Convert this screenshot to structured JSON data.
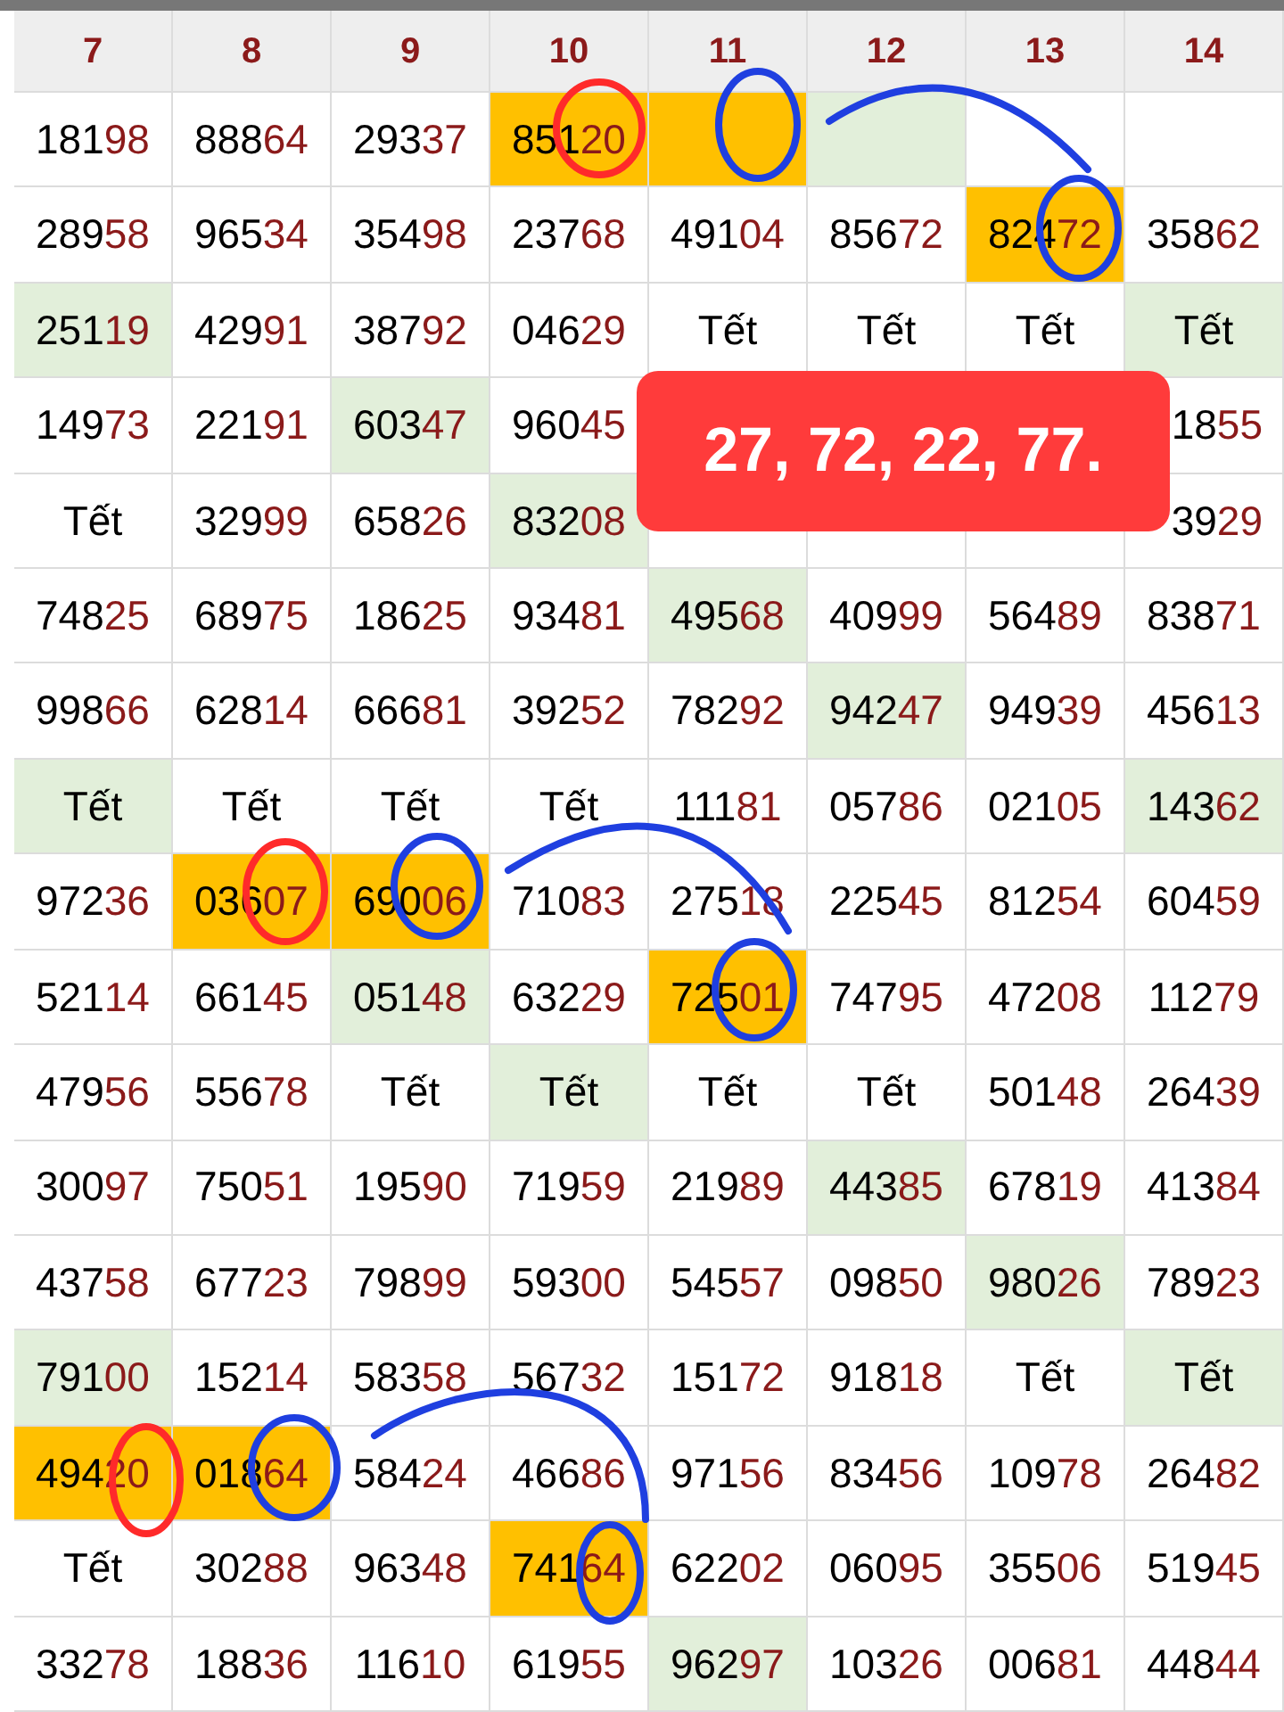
{
  "columns": [
    "7",
    "8",
    "9",
    "10",
    "11",
    "12",
    "13",
    "14"
  ],
  "rows": [
    {
      "cells": [
        {
          "kind": "number",
          "text": "18198"
        },
        {
          "kind": "number",
          "text": "88864"
        },
        {
          "kind": "number",
          "text": "29337"
        },
        {
          "kind": "number",
          "text": "85120",
          "color": "#ffc000"
        },
        {
          "kind": "empty",
          "color": "#ffc000"
        },
        {
          "kind": "empty",
          "color": "#e2efda"
        },
        {
          "kind": "empty"
        },
        {
          "kind": "empty"
        }
      ]
    },
    {
      "cells": [
        {
          "kind": "number",
          "text": "28958"
        },
        {
          "kind": "number",
          "text": "96534"
        },
        {
          "kind": "number",
          "text": "35498"
        },
        {
          "kind": "number",
          "text": "23768"
        },
        {
          "kind": "number",
          "text": "49104"
        },
        {
          "kind": "number",
          "text": "85672"
        },
        {
          "kind": "number",
          "text": "82472",
          "color": "#ffc000"
        },
        {
          "kind": "number",
          "text": "35862"
        }
      ]
    },
    {
      "cells": [
        {
          "kind": "number",
          "text": "25119",
          "color": "#e2efda"
        },
        {
          "kind": "number",
          "text": "42991"
        },
        {
          "kind": "number",
          "text": "38792"
        },
        {
          "kind": "number",
          "text": "04629"
        },
        {
          "kind": "holiday",
          "text": "Tết"
        },
        {
          "kind": "holiday",
          "text": "Tết"
        },
        {
          "kind": "holiday",
          "text": "Tết"
        },
        {
          "kind": "holiday",
          "text": "Tết",
          "color": "#e2efda"
        }
      ]
    },
    {
      "cells": [
        {
          "kind": "number",
          "text": "14973"
        },
        {
          "kind": "number",
          "text": "22191"
        },
        {
          "kind": "number",
          "text": "60347",
          "color": "#e2efda"
        },
        {
          "kind": "number",
          "text": "96045"
        },
        {
          "kind": "covered"
        },
        {
          "kind": "covered"
        },
        {
          "kind": "covered"
        },
        {
          "kind": "partial",
          "text": "1855"
        }
      ]
    },
    {
      "cells": [
        {
          "kind": "holiday",
          "text": "Tết"
        },
        {
          "kind": "number",
          "text": "32999"
        },
        {
          "kind": "number",
          "text": "65826"
        },
        {
          "kind": "number",
          "text": "83208",
          "color": "#e2efda"
        },
        {
          "kind": "empty"
        },
        {
          "kind": "empty"
        },
        {
          "kind": "empty"
        },
        {
          "kind": "partial",
          "text": "3929"
        }
      ]
    },
    {
      "cells": [
        {
          "kind": "number",
          "text": "74825"
        },
        {
          "kind": "number",
          "text": "68975"
        },
        {
          "kind": "number",
          "text": "18625"
        },
        {
          "kind": "number",
          "text": "93481"
        },
        {
          "kind": "number",
          "text": "49568",
          "color": "#e2efda"
        },
        {
          "kind": "number",
          "text": "40999"
        },
        {
          "kind": "number",
          "text": "56489"
        },
        {
          "kind": "number",
          "text": "83871"
        }
      ]
    },
    {
      "cells": [
        {
          "kind": "number",
          "text": "99866"
        },
        {
          "kind": "number",
          "text": "62814"
        },
        {
          "kind": "number",
          "text": "66681"
        },
        {
          "kind": "number",
          "text": "39252"
        },
        {
          "kind": "number",
          "text": "78292"
        },
        {
          "kind": "number",
          "text": "94247",
          "color": "#e2efda"
        },
        {
          "kind": "number",
          "text": "94939"
        },
        {
          "kind": "number",
          "text": "45613"
        }
      ]
    },
    {
      "cells": [
        {
          "kind": "holiday",
          "text": "Tết",
          "color": "#e2efda"
        },
        {
          "kind": "holiday",
          "text": "Tết"
        },
        {
          "kind": "holiday",
          "text": "Tết"
        },
        {
          "kind": "holiday",
          "text": "Tết"
        },
        {
          "kind": "number",
          "text": "11181"
        },
        {
          "kind": "number",
          "text": "05786"
        },
        {
          "kind": "number",
          "text": "02105"
        },
        {
          "kind": "number",
          "text": "14362",
          "color": "#e2efda"
        }
      ]
    },
    {
      "cells": [
        {
          "kind": "number",
          "text": "97236"
        },
        {
          "kind": "number",
          "text": "03607",
          "color": "#ffc000"
        },
        {
          "kind": "number",
          "text": "69006",
          "color": "#ffc000"
        },
        {
          "kind": "number",
          "text": "71083"
        },
        {
          "kind": "number",
          "text": "27518"
        },
        {
          "kind": "number",
          "text": "22545"
        },
        {
          "kind": "number",
          "text": "81254"
        },
        {
          "kind": "number",
          "text": "60459"
        }
      ]
    },
    {
      "cells": [
        {
          "kind": "number",
          "text": "52114"
        },
        {
          "kind": "number",
          "text": "66145"
        },
        {
          "kind": "number",
          "text": "05148",
          "color": "#e2efda"
        },
        {
          "kind": "number",
          "text": "63229"
        },
        {
          "kind": "number",
          "text": "72501",
          "color": "#ffc000"
        },
        {
          "kind": "number",
          "text": "74795"
        },
        {
          "kind": "number",
          "text": "47208"
        },
        {
          "kind": "number",
          "text": "11279"
        }
      ]
    },
    {
      "cells": [
        {
          "kind": "number",
          "text": "47956"
        },
        {
          "kind": "number",
          "text": "55678"
        },
        {
          "kind": "holiday",
          "text": "Tết"
        },
        {
          "kind": "holiday",
          "text": "Tết",
          "color": "#e2efda"
        },
        {
          "kind": "holiday",
          "text": "Tết"
        },
        {
          "kind": "holiday",
          "text": "Tết"
        },
        {
          "kind": "number",
          "text": "50148"
        },
        {
          "kind": "number",
          "text": "26439"
        }
      ]
    },
    {
      "cells": [
        {
          "kind": "number",
          "text": "30097"
        },
        {
          "kind": "number",
          "text": "75051"
        },
        {
          "kind": "number",
          "text": "19590"
        },
        {
          "kind": "number",
          "text": "71959"
        },
        {
          "kind": "number",
          "text": "21989"
        },
        {
          "kind": "number",
          "text": "44385",
          "color": "#e2efda"
        },
        {
          "kind": "number",
          "text": "67819"
        },
        {
          "kind": "number",
          "text": "41384"
        }
      ]
    },
    {
      "cells": [
        {
          "kind": "number",
          "text": "43758"
        },
        {
          "kind": "number",
          "text": "67723"
        },
        {
          "kind": "number",
          "text": "79899"
        },
        {
          "kind": "number",
          "text": "59300"
        },
        {
          "kind": "number",
          "text": "54557"
        },
        {
          "kind": "number",
          "text": "09850"
        },
        {
          "kind": "number",
          "text": "98026",
          "color": "#e2efda"
        },
        {
          "kind": "number",
          "text": "78923"
        }
      ]
    },
    {
      "cells": [
        {
          "kind": "number",
          "text": "79100",
          "color": "#e2efda"
        },
        {
          "kind": "number",
          "text": "15214"
        },
        {
          "kind": "number",
          "text": "58358"
        },
        {
          "kind": "number",
          "text": "56732"
        },
        {
          "kind": "number",
          "text": "15172"
        },
        {
          "kind": "number",
          "text": "91818"
        },
        {
          "kind": "holiday",
          "text": "Tết"
        },
        {
          "kind": "holiday",
          "text": "Tết",
          "color": "#e2efda"
        }
      ]
    },
    {
      "cells": [
        {
          "kind": "number",
          "text": "49420",
          "color": "#ffc000"
        },
        {
          "kind": "number",
          "text": "01864",
          "color": "#ffc000"
        },
        {
          "kind": "number",
          "text": "58424"
        },
        {
          "kind": "number",
          "text": "46686"
        },
        {
          "kind": "number",
          "text": "97156"
        },
        {
          "kind": "number",
          "text": "83456"
        },
        {
          "kind": "number",
          "text": "10978"
        },
        {
          "kind": "number",
          "text": "26482"
        }
      ]
    },
    {
      "cells": [
        {
          "kind": "holiday",
          "text": "Tết"
        },
        {
          "kind": "number",
          "text": "30288"
        },
        {
          "kind": "number",
          "text": "96348"
        },
        {
          "kind": "number",
          "text": "74164",
          "color": "#ffc000"
        },
        {
          "kind": "number",
          "text": "62202"
        },
        {
          "kind": "number",
          "text": "06095"
        },
        {
          "kind": "number",
          "text": "35506"
        },
        {
          "kind": "number",
          "text": "51945"
        }
      ]
    },
    {
      "cells": [
        {
          "kind": "number",
          "text": "33278"
        },
        {
          "kind": "number",
          "text": "18836"
        },
        {
          "kind": "number",
          "text": "11610"
        },
        {
          "kind": "number",
          "text": "61955"
        },
        {
          "kind": "number",
          "text": "96297",
          "color": "#e2efda"
        },
        {
          "kind": "number",
          "text": "10326"
        },
        {
          "kind": "number",
          "text": "00681"
        },
        {
          "kind": "number",
          "text": "44844"
        }
      ]
    }
  ],
  "banner": {
    "text": "27, 72, 22, 77."
  }
}
